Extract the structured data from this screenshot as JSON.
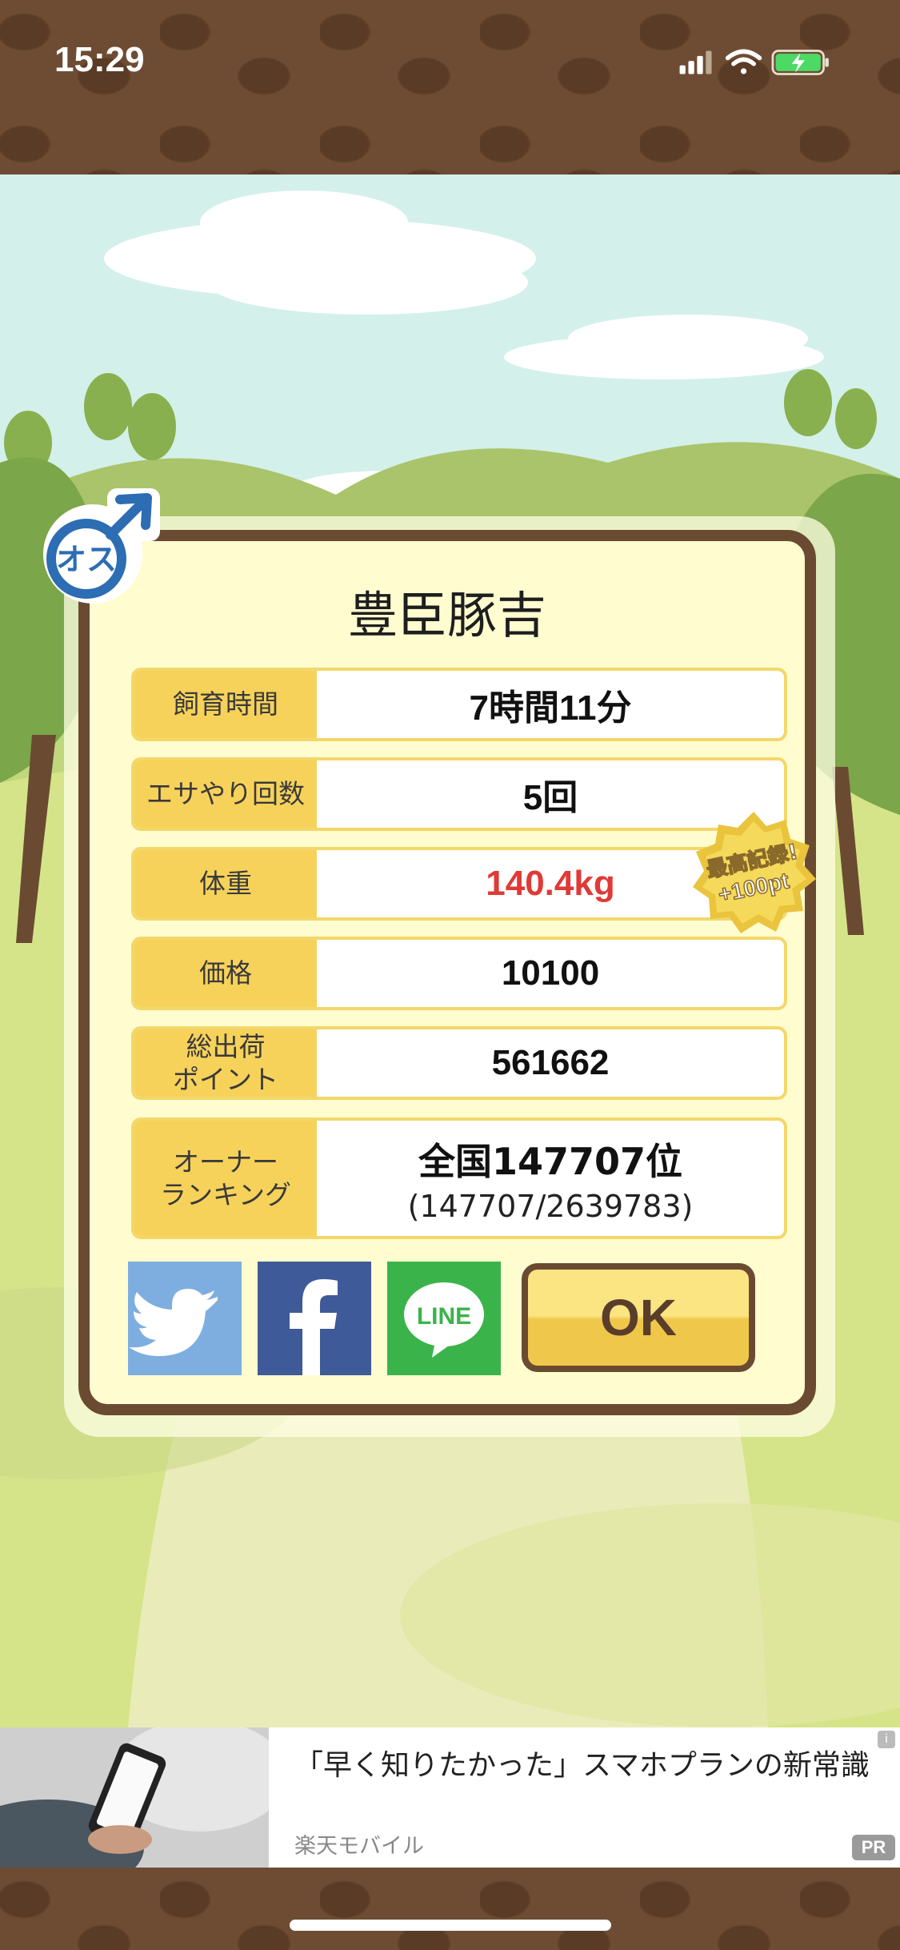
{
  "status_bar": {
    "time": "15:29"
  },
  "badge": {
    "sex_label": "オス"
  },
  "pig_name": "豊臣豚吉",
  "stats": [
    {
      "label": "飼育時間",
      "value": "7時間11分"
    },
    {
      "label": "エサやり回数",
      "value": "5回"
    },
    {
      "label": "体重",
      "value": "140.4kg"
    },
    {
      "label": "価格",
      "value": "10100"
    },
    {
      "label": "総出荷\nポイント",
      "value": "561662"
    }
  ],
  "ranking": {
    "label": "オーナー\nランキング",
    "rank": "全国147707位",
    "detail": "(147707/2639783)"
  },
  "record_badge": {
    "line1": "最高記録!",
    "line2": "+100pt"
  },
  "share": {
    "twitter_icon": "twitter-bird-icon",
    "facebook_icon": "facebook-f-icon",
    "line_label": "LINE"
  },
  "ok_button": {
    "label": "OK"
  },
  "ad": {
    "title": "「早く知りたかった」スマホプランの新常識",
    "sponsor": "楽天モバイル",
    "pr_label": "PR",
    "info_label": "i"
  },
  "colors": {
    "brown": "#6b4a32",
    "dialog_bg": "#fffdd0",
    "label_bg": "#f7d25a",
    "highlight_red": "#e03a36"
  }
}
